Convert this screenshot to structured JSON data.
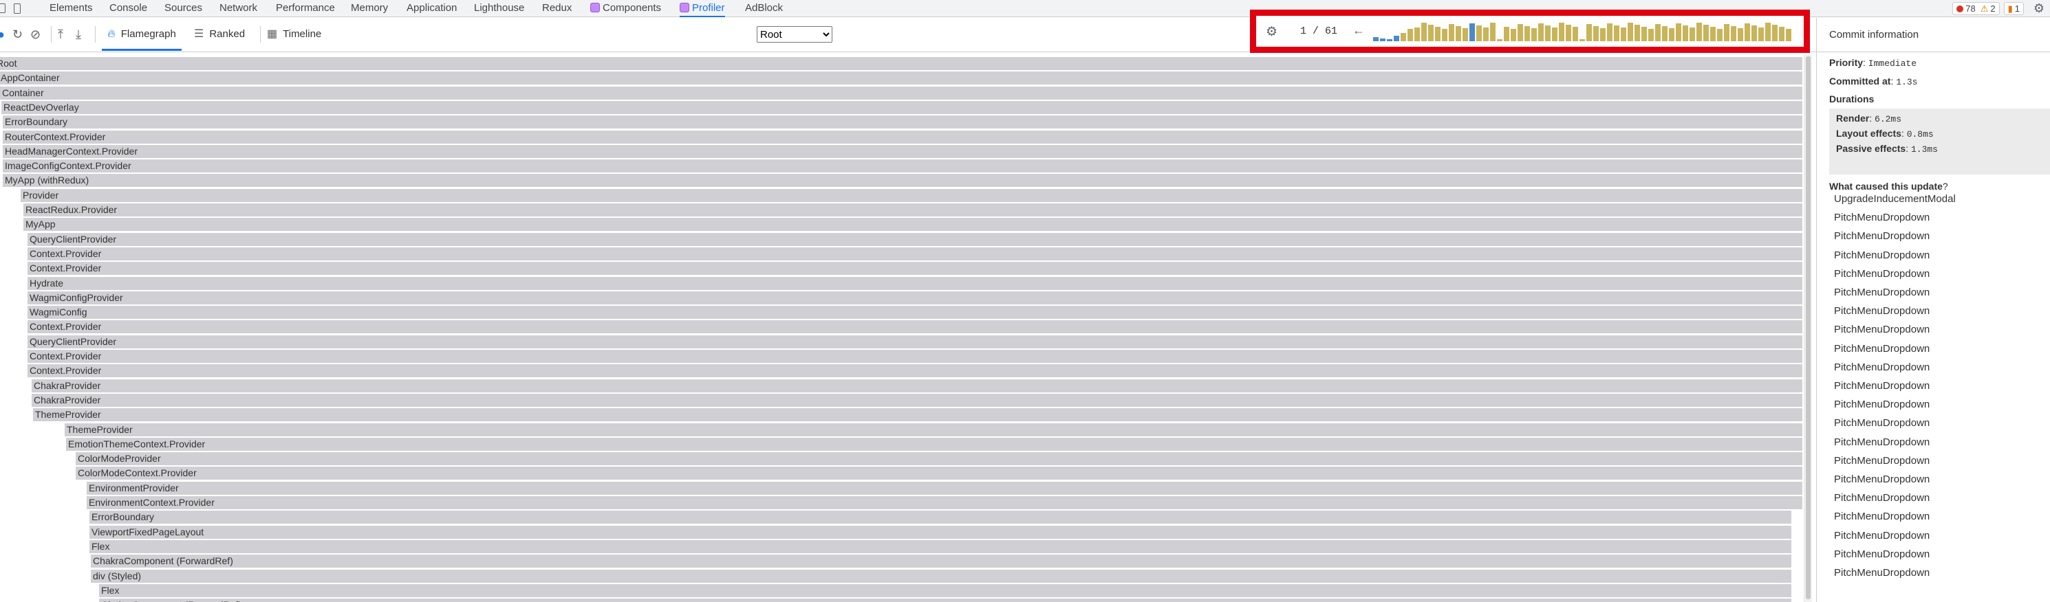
{
  "devtools_tabs": [
    {
      "label": "Elements"
    },
    {
      "label": "Console"
    },
    {
      "label": "Sources"
    },
    {
      "label": "Network"
    },
    {
      "label": "Performance"
    },
    {
      "label": "Memory"
    },
    {
      "label": "Application"
    },
    {
      "label": "Lighthouse"
    },
    {
      "label": "Redux"
    },
    {
      "label": "Components"
    },
    {
      "label": "Profiler"
    },
    {
      "label": "AdBlock"
    }
  ],
  "status": {
    "errors": "78",
    "warnings": "2",
    "messages": "1"
  },
  "profiler_tabs": [
    {
      "label": "Flamegraph",
      "icon": "flame-icon"
    },
    {
      "label": "Ranked",
      "icon": "ranked-icon"
    },
    {
      "label": "Timeline",
      "icon": "timeline-icon"
    }
  ],
  "root_select": {
    "selected": "Root"
  },
  "commit_nav": {
    "counter": "1 / 61"
  },
  "flamegraph": {
    "rows": [
      {
        "label": "Root"
      },
      {
        "label": "AppContainer"
      },
      {
        "label": "Container"
      },
      {
        "label": "ReactDevOverlay"
      },
      {
        "label": "ErrorBoundary"
      },
      {
        "label": "RouterContext.Provider"
      },
      {
        "label": "HeadManagerContext.Provider"
      },
      {
        "label": "ImageConfigContext.Provider"
      },
      {
        "label": "MyApp (withRedux)"
      },
      {
        "label": "Provider"
      },
      {
        "label": "ReactRedux.Provider"
      },
      {
        "label": "MyApp"
      },
      {
        "label": "QueryClientProvider"
      },
      {
        "label": "Context.Provider"
      },
      {
        "label": "Context.Provider"
      },
      {
        "label": "Hydrate"
      },
      {
        "label": "WagmiConfigProvider"
      },
      {
        "label": "WagmiConfig"
      },
      {
        "label": "Context.Provider"
      },
      {
        "label": "QueryClientProvider"
      },
      {
        "label": "Context.Provider"
      },
      {
        "label": "Context.Provider"
      },
      {
        "label": "ChakraProvider"
      },
      {
        "label": "ChakraProvider"
      },
      {
        "label": "ThemeProvider"
      },
      {
        "label": "ThemeProvider"
      },
      {
        "label": "EmotionThemeContext.Provider"
      },
      {
        "label": "ColorModeProvider"
      },
      {
        "label": "ColorModeContext.Provider"
      },
      {
        "label": "EnvironmentProvider"
      },
      {
        "label": "EnvironmentContext.Provider"
      },
      {
        "label": "ErrorBoundary"
      },
      {
        "label": "ViewportFixedPageLayout"
      },
      {
        "label": "Flex"
      },
      {
        "label": "ChakraComponent (ForwardRef)"
      },
      {
        "label": "div (Styled)"
      },
      {
        "label": "Flex"
      },
      {
        "label": "ChakraComponent (ForwardRef)"
      }
    ]
  },
  "commit_info": {
    "title": "Commit information",
    "priority_label": "Priority",
    "priority_value": "Immediate",
    "committed_label": "Committed at",
    "committed_value": "1.3s",
    "durations_label": "Durations",
    "render_label": "Render",
    "render_value": "6.2ms",
    "layout_label": "Layout effects",
    "layout_value": "0.8ms",
    "passive_label": "Passive effects",
    "passive_value": "1.3ms",
    "cause_label": "What caused this update",
    "causes": [
      {
        "name": "UpgradeInducementModal"
      },
      {
        "name": "PitchMenuDropdown"
      },
      {
        "name": "PitchMenuDropdown"
      },
      {
        "name": "PitchMenuDropdown"
      },
      {
        "name": "PitchMenuDropdown"
      },
      {
        "name": "PitchMenuDropdown"
      },
      {
        "name": "PitchMenuDropdown"
      },
      {
        "name": "PitchMenuDropdown"
      },
      {
        "name": "PitchMenuDropdown"
      },
      {
        "name": "PitchMenuDropdown"
      },
      {
        "name": "PitchMenuDropdown"
      },
      {
        "name": "PitchMenuDropdown"
      },
      {
        "name": "PitchMenuDropdown"
      },
      {
        "name": "PitchMenuDropdown"
      },
      {
        "name": "PitchMenuDropdown"
      },
      {
        "name": "PitchMenuDropdown"
      },
      {
        "name": "PitchMenuDropdown"
      },
      {
        "name": "PitchMenuDropdown"
      },
      {
        "name": "PitchMenuDropdown"
      },
      {
        "name": "PitchMenuDropdown"
      },
      {
        "name": "PitchMenuDropdown"
      }
    ]
  },
  "colors": {
    "accent": "#1a73e8",
    "highlight_border": "#e0000f",
    "commit_bar": "#c9b45a",
    "commit_bar_small": "#4a8ac9",
    "flame_bar": "#d0d0d4"
  }
}
